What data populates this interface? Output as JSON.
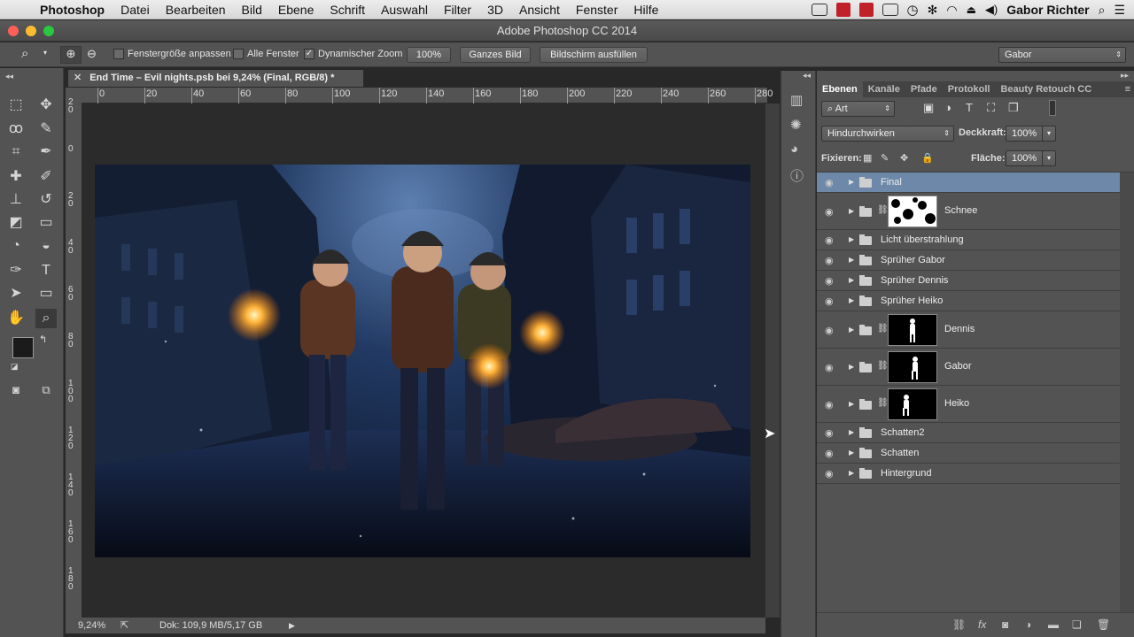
{
  "menubar": {
    "app_name": "Photoshop",
    "items": [
      "Datei",
      "Bearbeiten",
      "Bild",
      "Ebene",
      "Schrift",
      "Auswahl",
      "Filter",
      "3D",
      "Ansicht",
      "Fenster",
      "Hilfe"
    ],
    "user": "Gabor Richter"
  },
  "window": {
    "title": "Adobe Photoshop CC 2014"
  },
  "options": {
    "resize_windows": "Fenstergröße anpassen",
    "all_windows": "Alle Fenster",
    "scrubby_zoom": "Dynamischer Zoom",
    "zoom_100": "100%",
    "fit_screen": "Ganzes Bild",
    "fill_screen": "Bildschirm ausfüllen",
    "workspace": "Gabor",
    "scrubby_zoom_checked": true
  },
  "document": {
    "tab_title": "End Time – Evil nights.psb bei 9,24% (Final, RGB/8) *",
    "zoom_status": "9,24%",
    "doc_size": "Dok: 109,9 MB/5,17 GB",
    "h_ruler_ticks": [
      "0",
      "20",
      "40",
      "60",
      "80",
      "100",
      "120",
      "140",
      "160",
      "180",
      "200",
      "220",
      "240",
      "260",
      "280"
    ],
    "v_ruler_ticks": [
      "2 0",
      "0",
      "2 0",
      "4 0",
      "6 0",
      "8 0",
      "1 0 0",
      "1 2 0",
      "1 4 0",
      "1 6 0",
      "1 8 0"
    ]
  },
  "layers_panel": {
    "tabs": [
      "Ebenen",
      "Kanäle",
      "Pfade",
      "Protokoll",
      "Beauty Retouch CC"
    ],
    "active_tab": "Ebenen",
    "filter_kind": "Art",
    "blend_mode": "Hindurchwirken",
    "opacity_label": "Deckkraft:",
    "opacity_value": "100%",
    "lock_label": "Fixieren:",
    "fill_label": "Fläche:",
    "fill_value": "100%",
    "layers": [
      {
        "name": "Final",
        "selected": true
      },
      {
        "name": "Schnee",
        "thumb": "snow-mask"
      },
      {
        "name": "Licht überstrahlung"
      },
      {
        "name": "Sprüher Gabor"
      },
      {
        "name": "Sprüher Dennis"
      },
      {
        "name": "Sprüher Heiko"
      },
      {
        "name": "Dennis",
        "thumb": "person-mask"
      },
      {
        "name": "Gabor",
        "thumb": "person-mask"
      },
      {
        "name": "Heiko",
        "thumb": "person-mask"
      },
      {
        "name": "Schatten2"
      },
      {
        "name": "Schatten"
      },
      {
        "name": "Hintergrund"
      }
    ]
  },
  "colors": {
    "foreground": "#1b1b1b",
    "background": "#2f8fd8",
    "selection": "#6d88a8"
  }
}
